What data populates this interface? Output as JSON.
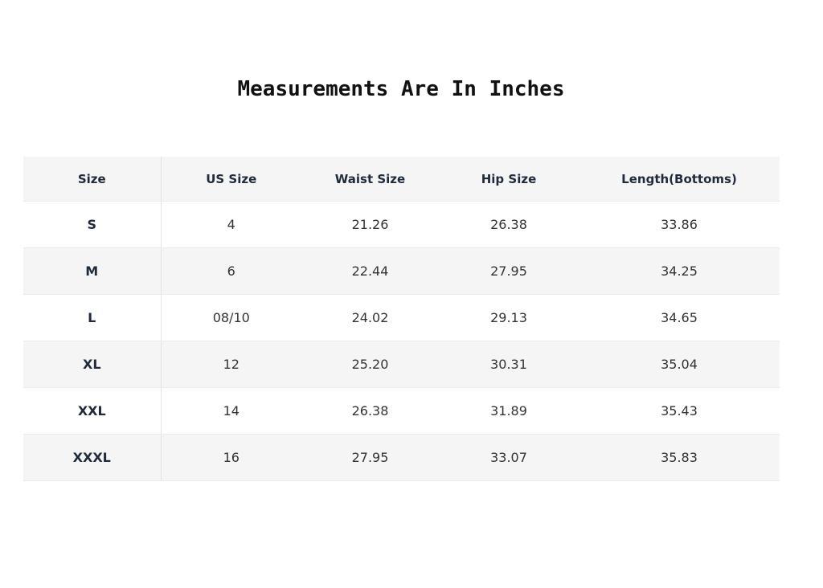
{
  "title": "Measurements Are In Inches",
  "table": {
    "headers": [
      "Size",
      "US Size",
      "Waist Size",
      "Hip Size",
      "Length(Bottoms)"
    ],
    "rows": [
      [
        "S",
        "4",
        "21.26",
        "26.38",
        "33.86"
      ],
      [
        "M",
        "6",
        "22.44",
        "27.95",
        "34.25"
      ],
      [
        "L",
        "08/10",
        "24.02",
        "29.13",
        "34.65"
      ],
      [
        "XL",
        "12",
        "25.20",
        "30.31",
        "35.04"
      ],
      [
        "XXL",
        "14",
        "26.38",
        "31.89",
        "35.43"
      ],
      [
        "XXXL",
        "16",
        "27.95",
        "33.07",
        "35.83"
      ]
    ]
  },
  "colors": {
    "header_bg": "#f5f5f5",
    "stripe_bg": "#f5f5f5",
    "size_text": "#1f2a3a",
    "divider": "#e3e3e3"
  }
}
